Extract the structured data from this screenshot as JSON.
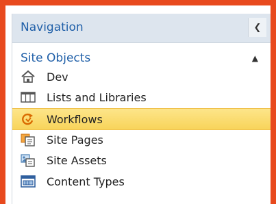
{
  "nav": {
    "title": "Navigation",
    "collapse_icon": "chevron-left-icon"
  },
  "section": {
    "title": "Site Objects",
    "toggle_icon": "chevron-up-icon"
  },
  "items": [
    {
      "label": "Dev",
      "icon": "home-icon"
    },
    {
      "label": "Lists and Libraries",
      "icon": "table-icon"
    },
    {
      "label": "Workflows",
      "icon": "workflow-icon",
      "selected": true
    },
    {
      "label": "Site Pages",
      "icon": "site-pages-icon"
    },
    {
      "label": "Site Assets",
      "icon": "site-assets-icon"
    },
    {
      "label": "Content Types",
      "icon": "content-types-icon"
    }
  ],
  "colors": {
    "border": "#e84a1e",
    "header_bg": "#dde5ee",
    "link": "#1f5fa8",
    "selected_bg": "#f8d45a"
  }
}
